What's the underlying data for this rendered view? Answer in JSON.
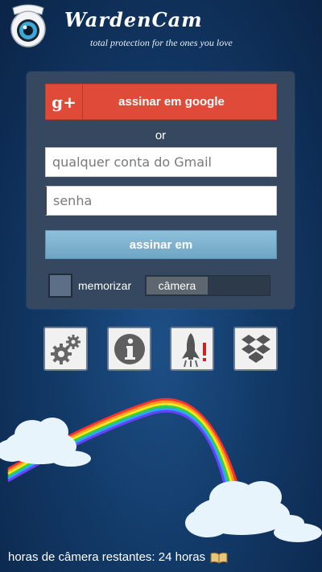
{
  "app": {
    "title": "WardenCam",
    "tagline": "total protection for the ones you love"
  },
  "login": {
    "google_icon_text": "g+",
    "google_button": "assinar em google",
    "or_text": "or",
    "email_placeholder": "qualquer conta do Gmail",
    "email_value": "",
    "password_placeholder": "senha",
    "password_value": "",
    "signin_button": "assinar em",
    "remember_label": "memorizar",
    "remember_checked": false,
    "mode_toggle_label": "câmera"
  },
  "toolbar": {
    "items": [
      {
        "icon": "gears-icon",
        "name": "settings"
      },
      {
        "icon": "info-icon",
        "name": "info"
      },
      {
        "icon": "rocket-launch-icon",
        "name": "launch"
      },
      {
        "icon": "dropbox-icon",
        "name": "dropbox"
      }
    ]
  },
  "footer": {
    "camera_hours_text": "horas de câmera restantes: 24 horas",
    "icon": "open-book-icon"
  },
  "colors": {
    "google_red": "#df4b38",
    "signin_blue": "#7ab0cd",
    "panel": "#35485f",
    "background": "#123a68"
  }
}
